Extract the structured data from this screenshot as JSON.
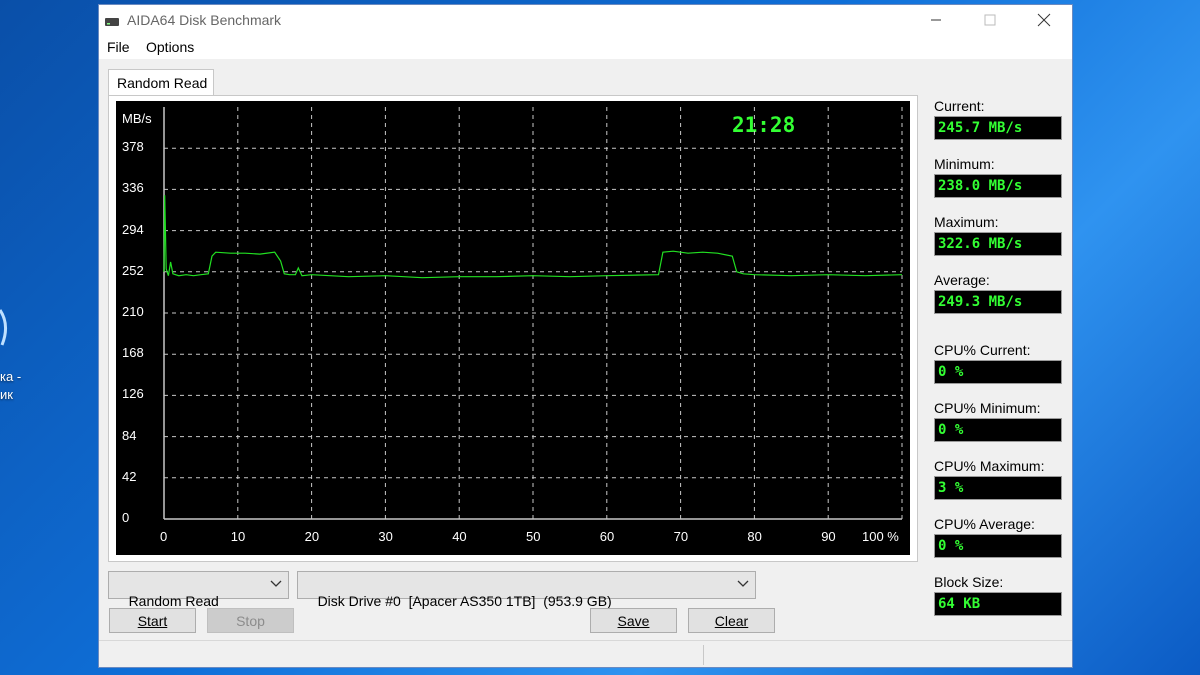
{
  "desktop": {
    "icon_label": "ка -\nик"
  },
  "window": {
    "title": "AIDA64 Disk Benchmark",
    "controls": {
      "minimize": "—",
      "maximize": "☐",
      "close": "✕"
    }
  },
  "menu": [
    "File",
    "Options"
  ],
  "tab": {
    "label": "Random Read"
  },
  "clock": "21:28",
  "stats": [
    {
      "label": "Current:",
      "value": "245.7 MB/s"
    },
    {
      "label": "Minimum:",
      "value": "238.0 MB/s"
    },
    {
      "label": "Maximum:",
      "value": "322.6 MB/s"
    },
    {
      "label": "Average:",
      "value": "249.3 MB/s"
    },
    {
      "label": "CPU% Current:",
      "value": "0 %"
    },
    {
      "label": "CPU% Minimum:",
      "value": "0 %"
    },
    {
      "label": "CPU% Maximum:",
      "value": "3 %"
    },
    {
      "label": "CPU% Average:",
      "value": "0 %"
    },
    {
      "label": "Block Size:",
      "value": "64 KB"
    }
  ],
  "controls": {
    "test_select": "Random Read",
    "drive_select": "Disk Drive #0  [Apacer AS350 1TB]  (953.9 GB)",
    "start": "Start",
    "stop": "Stop",
    "save": "Save",
    "clear": "Clear"
  },
  "colors": {
    "trace": "#22e022",
    "grid": "#c8c8c8",
    "readout": "#33ff33"
  },
  "chart_data": {
    "type": "line",
    "ylabel": "MB/s",
    "y_ticks": [
      "378",
      "336",
      "294",
      "252",
      "210",
      "168",
      "126",
      "84",
      "42",
      "0"
    ],
    "x_ticks": [
      "0",
      "10",
      "20",
      "30",
      "40",
      "50",
      "60",
      "70",
      "80",
      "90",
      "100 %"
    ],
    "xlim": [
      0,
      100
    ],
    "ylim": [
      0,
      420
    ],
    "grid": true,
    "series": [
      {
        "points": [
          [
            0,
            252
          ],
          [
            0.1,
            330
          ],
          [
            0.3,
            255
          ],
          [
            0.6,
            248
          ],
          [
            0.9,
            262
          ],
          [
            1.2,
            250
          ],
          [
            2,
            248
          ],
          [
            3,
            249
          ],
          [
            4,
            248
          ],
          [
            5,
            249
          ],
          [
            6,
            250
          ],
          [
            6.5,
            268
          ],
          [
            7,
            272
          ],
          [
            9,
            271
          ],
          [
            11,
            271
          ],
          [
            13,
            270
          ],
          [
            15,
            272
          ],
          [
            15.8,
            263
          ],
          [
            16.3,
            250
          ],
          [
            17,
            249
          ],
          [
            17.8,
            249
          ],
          [
            18.2,
            256
          ],
          [
            18.7,
            248
          ],
          [
            20,
            249
          ],
          [
            25,
            247
          ],
          [
            30,
            248
          ],
          [
            35,
            246
          ],
          [
            40,
            247
          ],
          [
            45,
            247
          ],
          [
            50,
            248
          ],
          [
            55,
            247
          ],
          [
            60,
            248
          ],
          [
            67,
            249
          ],
          [
            67.6,
            272
          ],
          [
            69,
            273
          ],
          [
            71,
            271
          ],
          [
            73,
            272
          ],
          [
            75,
            271
          ],
          [
            77,
            268
          ],
          [
            77.6,
            252
          ],
          [
            78.5,
            250
          ],
          [
            80,
            249
          ],
          [
            85,
            248
          ],
          [
            90,
            249
          ],
          [
            95,
            248
          ],
          [
            100,
            249
          ]
        ]
      }
    ]
  }
}
